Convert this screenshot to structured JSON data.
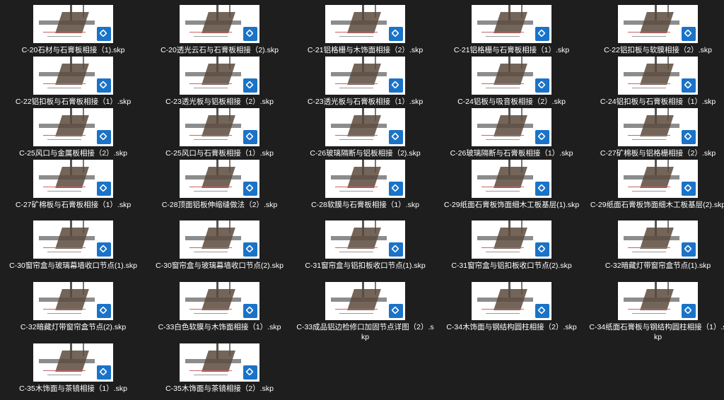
{
  "files": [
    {
      "name": "C-20石材与石膏板相接（1).skp",
      "icon": "sketchup-icon"
    },
    {
      "name": "C-20透光云石与石膏板相接（2).skp",
      "icon": "sketchup-icon"
    },
    {
      "name": "C-21铝格栅与木饰面相接（2）.skp",
      "icon": "sketchup-icon"
    },
    {
      "name": "C-21铝格栅与石膏板相接（1）.skp",
      "icon": "sketchup-icon"
    },
    {
      "name": "C-22铝扣板与软膜相接（2）.skp",
      "icon": "sketchup-icon"
    },
    {
      "name": "C-22铝扣板与石膏板相接（1）.skp",
      "icon": "sketchup-icon"
    },
    {
      "name": "C-23透光板与铝板相接（2）.skp",
      "icon": "sketchup-icon"
    },
    {
      "name": "C-23透光板与石膏板相接（1）.skp",
      "icon": "sketchup-icon"
    },
    {
      "name": "C-24铝板与吸音板相接（2）.skp",
      "icon": "sketchup-icon"
    },
    {
      "name": "C-24铝扣板与石膏板相接（1）.skp",
      "icon": "sketchup-icon"
    },
    {
      "name": "C-25风口与金属板相接（2）.skp",
      "icon": "sketchup-icon"
    },
    {
      "name": "C-25风口与石膏板相接（1）.skp",
      "icon": "sketchup-icon"
    },
    {
      "name": "C-26玻璃隔断与铝板相接（2).skp",
      "icon": "sketchup-icon"
    },
    {
      "name": "C-26玻璃隔断与石膏板相接（1）.skp",
      "icon": "sketchup-icon"
    },
    {
      "name": "C-27矿棉板与铝格栅相接（2）.skp",
      "icon": "sketchup-icon"
    },
    {
      "name": "C-27矿棉板与石膏板相接（1）.skp",
      "icon": "sketchup-icon"
    },
    {
      "name": "C-28顶面铝板伸缩缝做法（2）.skp",
      "icon": "sketchup-icon"
    },
    {
      "name": "C-28软膜与石膏板相接（1）.skp",
      "icon": "sketchup-icon"
    },
    {
      "name": "C-29纸面石膏板饰面细木工板基层(1).skp",
      "icon": "sketchup-icon"
    },
    {
      "name": "C-29纸面石膏板饰面细木工板基层(2).skp",
      "icon": "sketchup-icon"
    },
    {
      "name": "C-30窗帘盒与玻璃幕墙收口节点(1).skp",
      "icon": "sketchup-icon"
    },
    {
      "name": "C-30窗帘盒与玻璃幕墙收口节点(2).skp",
      "icon": "sketchup-icon"
    },
    {
      "name": "C-31窗帘盒与铝扣板收口节点(1).skp",
      "icon": "sketchup-icon"
    },
    {
      "name": "C-31窗帘盒与铝扣板收口节点(2).skp",
      "icon": "sketchup-icon"
    },
    {
      "name": "C-32暗藏灯带窗帘盒节点(1).skp",
      "icon": "sketchup-icon"
    },
    {
      "name": "C-32暗藏灯带窗帘盒节点(2).skp",
      "icon": "sketchup-icon"
    },
    {
      "name": "C-33白色软膜与木饰面相接（1）.skp",
      "icon": "sketchup-icon"
    },
    {
      "name": "C-33成品铝边检修口加固节点详图（2）.skp",
      "icon": "sketchup-icon"
    },
    {
      "name": "C-34木饰面与钢结构圆柱相接（2）.skp",
      "icon": "sketchup-icon"
    },
    {
      "name": "C-34纸面石膏板与钢结构圆柱相接（1）.skp",
      "icon": "sketchup-icon"
    },
    {
      "name": "C-35木饰面与茶镜相接（1）.skp",
      "icon": "sketchup-icon"
    },
    {
      "name": "C-35木饰面与茶镜相接（2）.skp",
      "icon": "sketchup-icon"
    }
  ]
}
